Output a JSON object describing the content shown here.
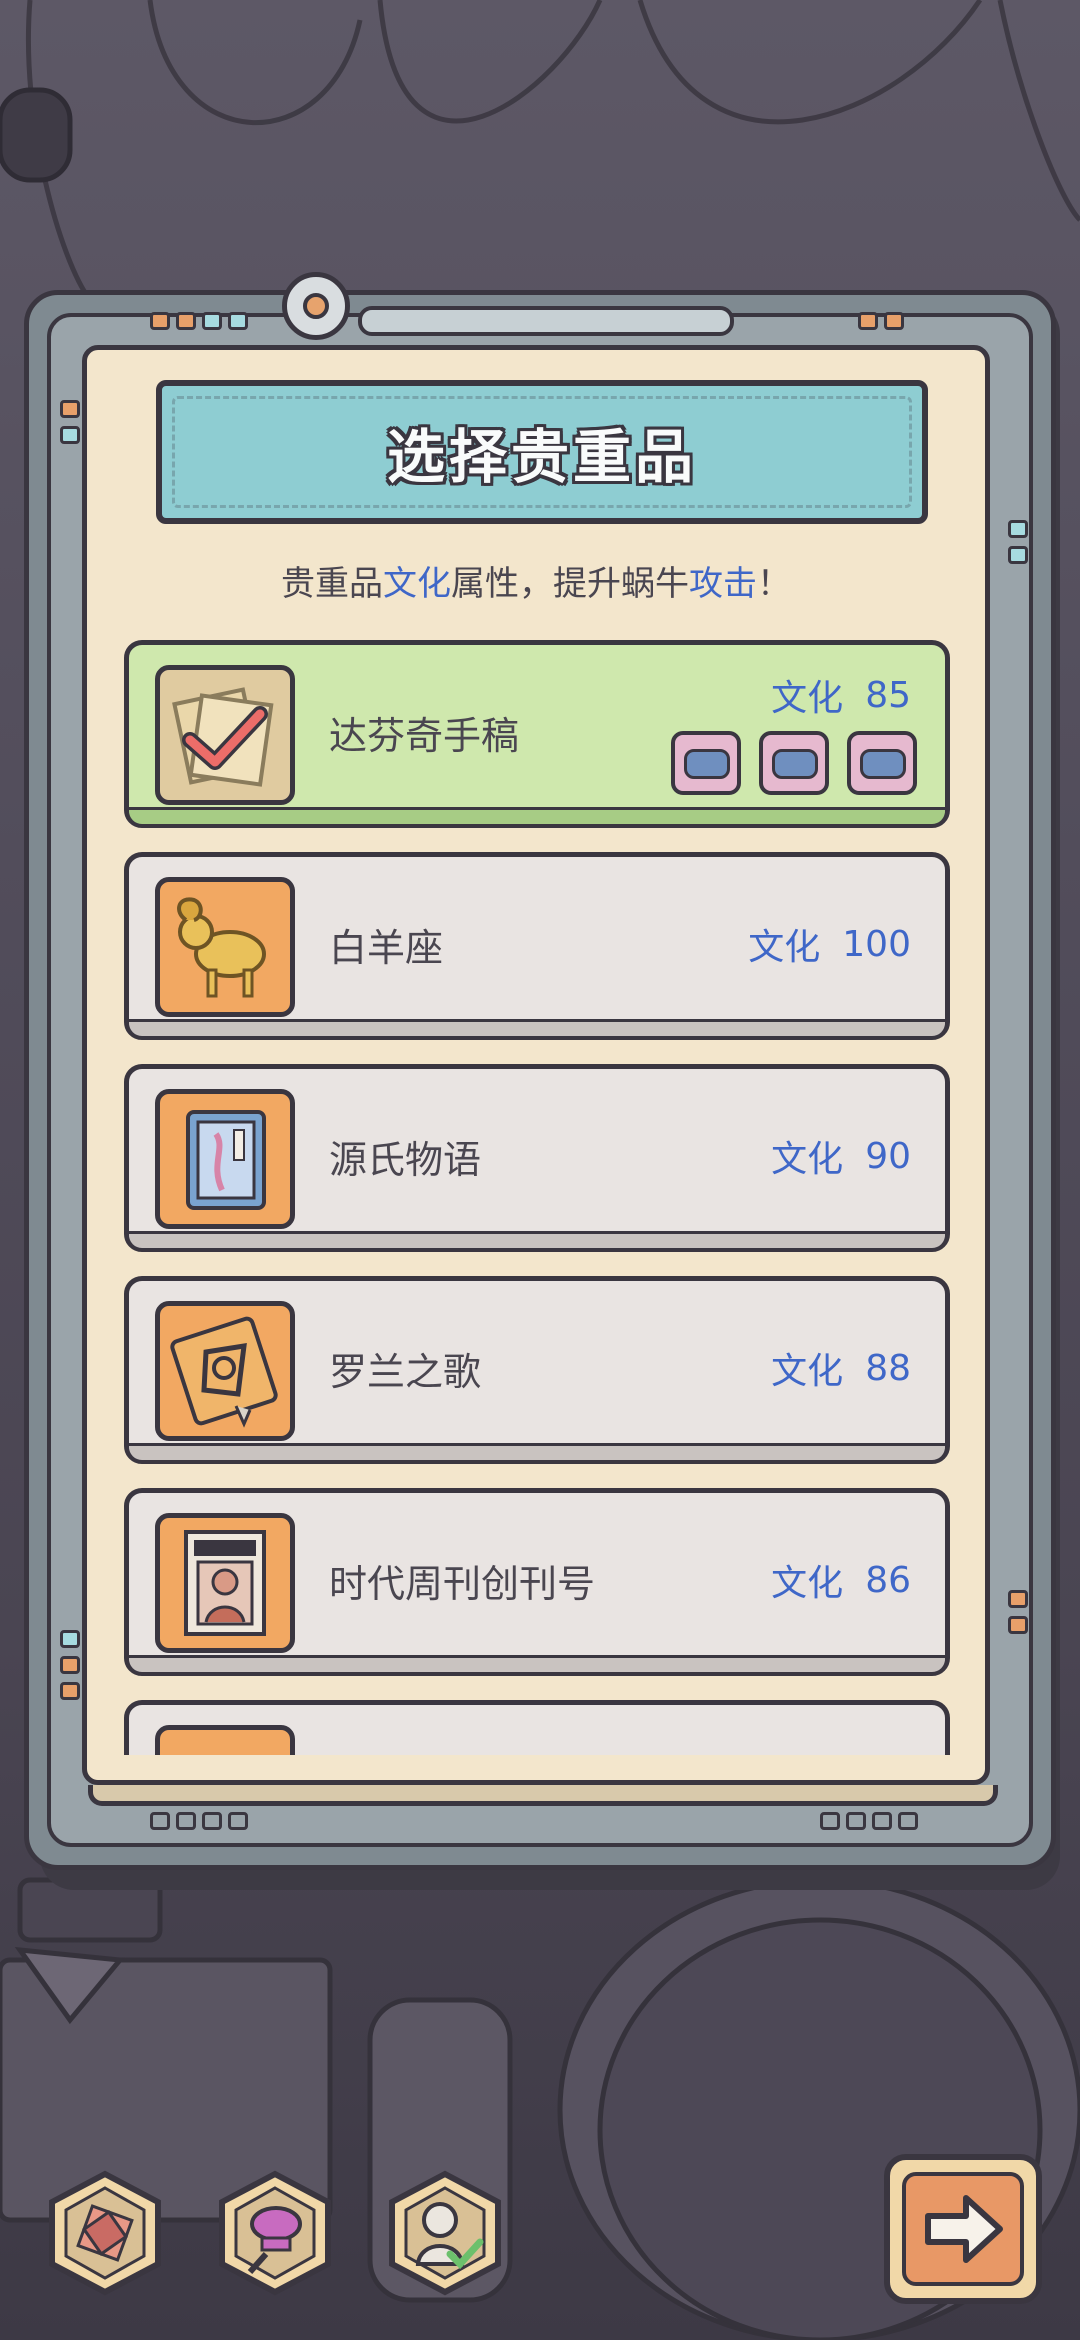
{
  "header": {
    "title": "选择贵重品",
    "subtitle_parts": [
      "贵重品",
      "文化",
      "属性，提升蜗牛",
      "攻击",
      "！"
    ]
  },
  "items": [
    {
      "name": "达芬奇手稿",
      "attr_label": "文化",
      "attr_value": "85",
      "selected": true,
      "icon": "checked-manuscript-icon"
    },
    {
      "name": "白羊座",
      "attr_label": "文化",
      "attr_value": "100",
      "selected": false,
      "icon": "golden-ram-icon"
    },
    {
      "name": "源氏物语",
      "attr_label": "文化",
      "attr_value": "90",
      "selected": false,
      "icon": "book-icon"
    },
    {
      "name": "罗兰之歌",
      "attr_label": "文化",
      "attr_value": "88",
      "selected": false,
      "icon": "ornate-book-icon"
    },
    {
      "name": "时代周刊创刊号",
      "attr_label": "文化",
      "attr_value": "86",
      "selected": false,
      "icon": "magazine-icon"
    }
  ],
  "colors": {
    "accent_blue": "#3f67c8",
    "selected_green": "#cfe8ad",
    "thumb_orange": "#f2a862",
    "outline": "#3a3640"
  }
}
